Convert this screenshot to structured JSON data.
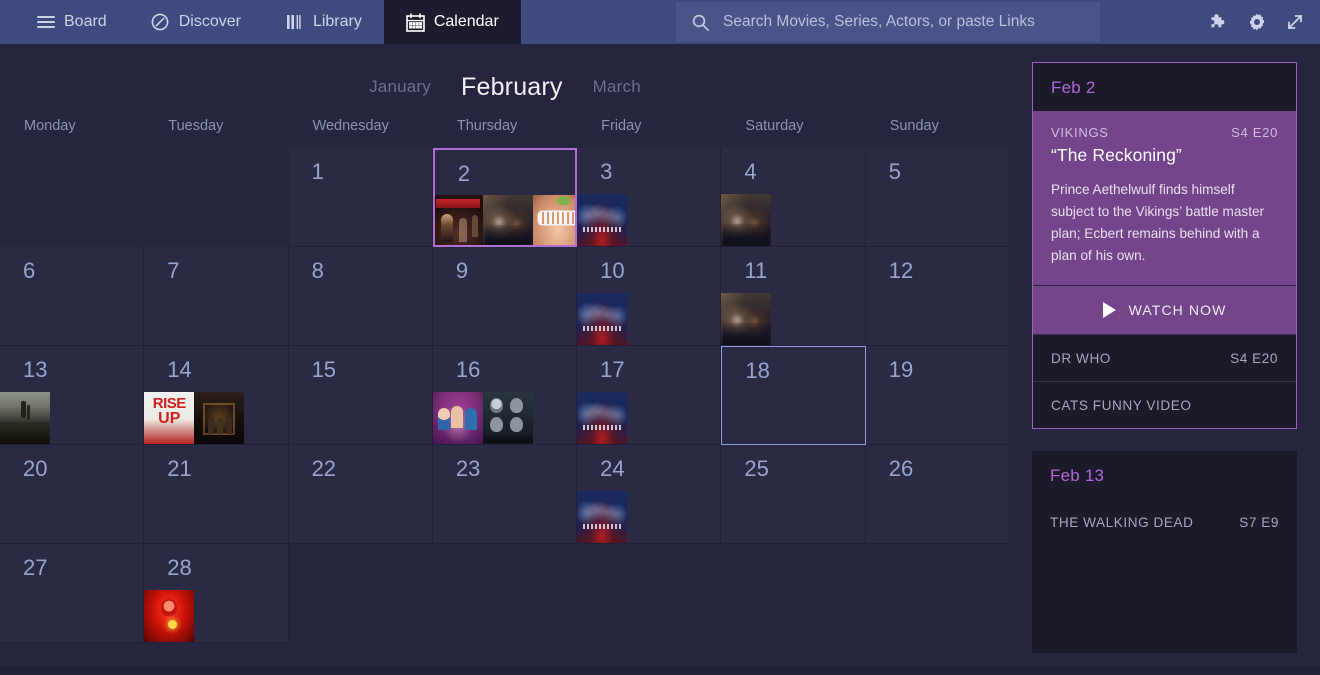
{
  "topbar": {
    "tabs": [
      {
        "label": "Board",
        "icon": "hamburger-icon",
        "active": false
      },
      {
        "label": "Discover",
        "icon": "compass-icon",
        "active": false
      },
      {
        "label": "Library",
        "icon": "bars-icon",
        "active": false
      },
      {
        "label": "Calendar",
        "icon": "calendar-icon",
        "active": true
      }
    ],
    "search": {
      "placeholder": "Search Movies, Series, Actors, or paste Links",
      "value": ""
    },
    "actions": [
      {
        "name": "puzzle-icon",
        "label": "Plugins"
      },
      {
        "name": "gear-icon",
        "label": "Settings"
      },
      {
        "name": "expand-icon",
        "label": "Fullscreen"
      }
    ]
  },
  "month_nav": {
    "prev": "January",
    "current": "February",
    "next": "March"
  },
  "weekdays": [
    "Monday",
    "Tuesday",
    "Wednesday",
    "Thursday",
    "Friday",
    "Saturday",
    "Sunday"
  ],
  "calendar": {
    "cells": [
      {
        "day": "",
        "blank": true
      },
      {
        "day": "",
        "blank": true
      },
      {
        "day": "1",
        "thumbs": []
      },
      {
        "day": "2",
        "selected": true,
        "thumbs": [
          "art-reckoning",
          "art-drwho",
          "art-cats"
        ]
      },
      {
        "day": "3",
        "thumbs": [
          "art-supernatural"
        ]
      },
      {
        "day": "4",
        "thumbs": [
          "art-drwho"
        ]
      },
      {
        "day": "5",
        "thumbs": []
      },
      {
        "day": "6",
        "thumbs": []
      },
      {
        "day": "7",
        "thumbs": []
      },
      {
        "day": "8",
        "thumbs": []
      },
      {
        "day": "9",
        "thumbs": []
      },
      {
        "day": "10",
        "thumbs": [
          "art-supernatural"
        ]
      },
      {
        "day": "11",
        "thumbs": [
          "art-drwho"
        ]
      },
      {
        "day": "12",
        "thumbs": []
      },
      {
        "day": "13",
        "thumbs": [
          "art-twd"
        ]
      },
      {
        "day": "14",
        "thumbs": [
          "art-riseup",
          "art-dark-group"
        ]
      },
      {
        "day": "15",
        "thumbs": []
      },
      {
        "day": "16",
        "thumbs": [
          "art-bigbang",
          "art-got"
        ]
      },
      {
        "day": "17",
        "thumbs": [
          "art-supernatural"
        ]
      },
      {
        "day": "18",
        "today": true,
        "thumbs": []
      },
      {
        "day": "19",
        "thumbs": []
      },
      {
        "day": "20",
        "thumbs": []
      },
      {
        "day": "21",
        "thumbs": []
      },
      {
        "day": "22",
        "thumbs": []
      },
      {
        "day": "23",
        "thumbs": []
      },
      {
        "day": "24",
        "thumbs": [
          "art-supernatural"
        ]
      },
      {
        "day": "25",
        "thumbs": []
      },
      {
        "day": "26",
        "thumbs": []
      },
      {
        "day": "27",
        "thumbs": []
      },
      {
        "day": "28",
        "thumbs": [
          "art-flash"
        ]
      },
      {
        "day": "",
        "blank": true
      },
      {
        "day": "",
        "blank": true
      },
      {
        "day": "",
        "blank": true
      },
      {
        "day": "",
        "blank": true
      },
      {
        "day": "",
        "blank": true
      }
    ]
  },
  "sidebar": {
    "cards": [
      {
        "date": "Feb 2",
        "featured": {
          "show": "VIKINGS",
          "code": "S4 E20",
          "title": "“The Reckoning”",
          "description": "Prince Aethelwulf finds himself subject to the Vikings’ battle master plan; Ecbert remains behind with a plan of his own.",
          "watch_label": "WATCH NOW"
        },
        "rows": [
          {
            "show": "DR WHO",
            "code": "S4 E20"
          },
          {
            "show": "CATS FUNNY VIDEO",
            "code": ""
          }
        ]
      },
      {
        "date": "Feb 13",
        "rows": [
          {
            "show": "THE WALKING DEAD",
            "code": "S7 E9"
          }
        ]
      }
    ]
  },
  "colors": {
    "topbar": "#3f4a7e",
    "active_tab": "#1c1c2e",
    "page_bg": "#252540",
    "cell_bg": "#2a2a45",
    "accent_purple": "#b069d6",
    "feature_purple": "#74458b",
    "today_border": "#8f9ddb",
    "selected_border": "#b06fd0"
  }
}
